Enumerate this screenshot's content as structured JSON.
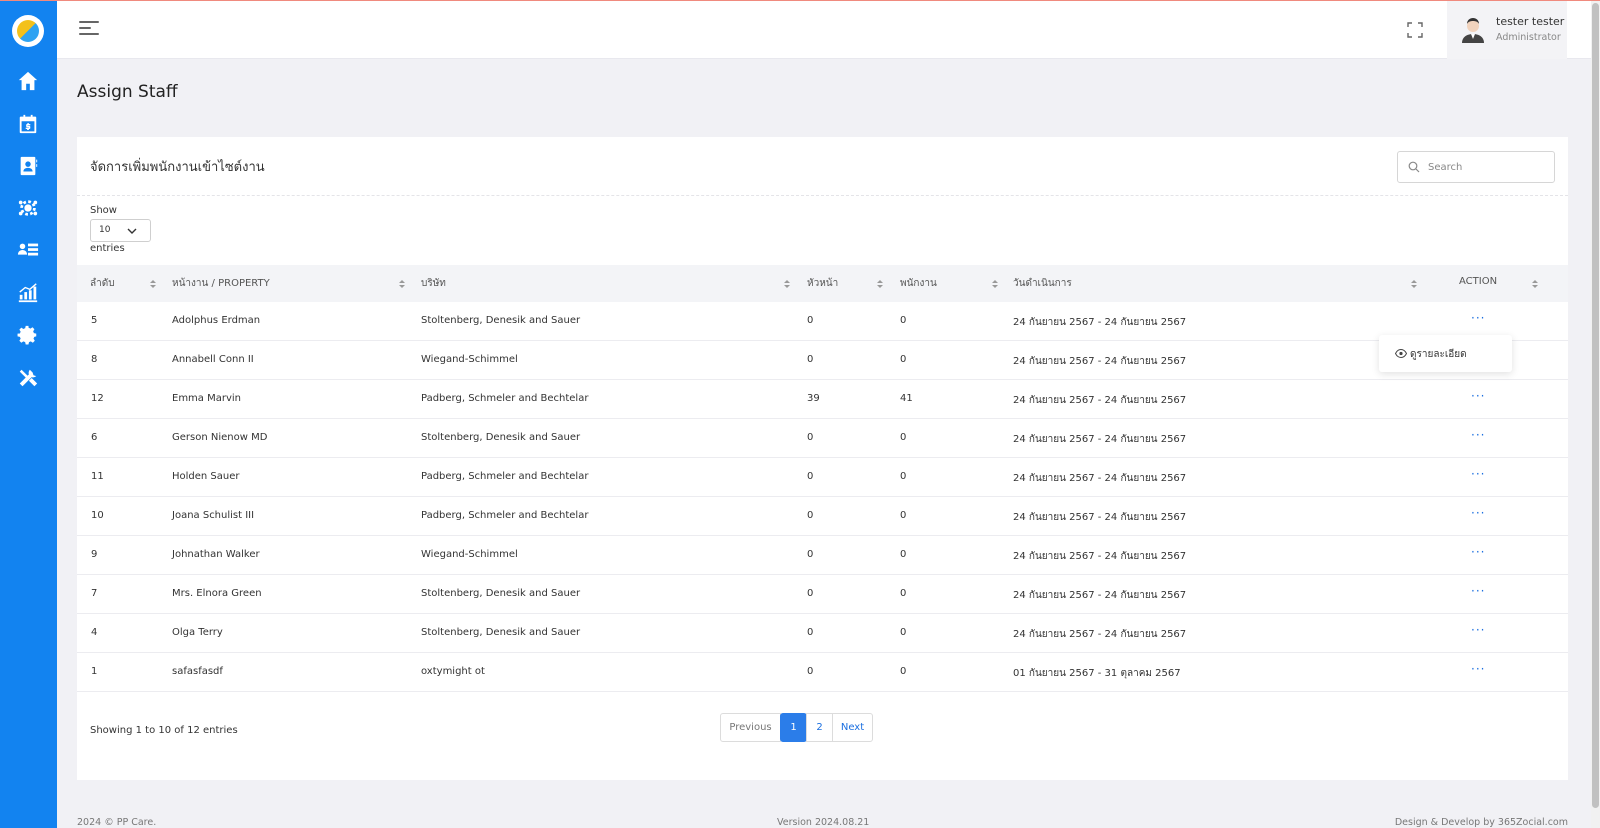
{
  "app": {
    "brand_color": "#1283f0"
  },
  "sidebar": {
    "items": [
      {
        "icon": "home-icon"
      },
      {
        "icon": "calendar-dollar-icon"
      },
      {
        "icon": "contact-book-icon"
      },
      {
        "icon": "team-gear-icon"
      },
      {
        "icon": "staff-list-icon"
      },
      {
        "icon": "bar-chart-icon"
      },
      {
        "icon": "settings-gear-icon"
      },
      {
        "icon": "tools-icon"
      }
    ]
  },
  "header": {
    "user_name": "tester tester",
    "user_role": "Administrator"
  },
  "page": {
    "title": "Assign Staff"
  },
  "card": {
    "title": "จัดการเพิ่มพนักงานเข้าไซต์งาน",
    "search_placeholder": "Search",
    "show_label": "Show",
    "entries_value": "10",
    "entries_label": "entries"
  },
  "table": {
    "headers": [
      "ลำดับ",
      "หน้างาน / PROPERTY",
      "บริษัท",
      "หัวหน้า",
      "พนักงาน",
      "วันดำเนินการ",
      "ACTION"
    ],
    "rows": [
      {
        "no": "5",
        "property": "Adolphus Erdman",
        "company": "Stoltenberg, Denesik and Sauer",
        "head": "0",
        "staff": "0",
        "date": "24 กันยายน 2567 - 24 กันยายน 2567"
      },
      {
        "no": "8",
        "property": "Annabell Conn II",
        "company": "Wiegand-Schimmel",
        "head": "0",
        "staff": "0",
        "date": "24 กันยายน 2567 - 24 กันยายน 2567"
      },
      {
        "no": "12",
        "property": "Emma Marvin",
        "company": "Padberg, Schmeler and Bechtelar",
        "head": "39",
        "staff": "41",
        "date": "24 กันยายน 2567 - 24 กันยายน 2567"
      },
      {
        "no": "6",
        "property": "Gerson Nienow MD",
        "company": "Stoltenberg, Denesik and Sauer",
        "head": "0",
        "staff": "0",
        "date": "24 กันยายน 2567 - 24 กันยายน 2567"
      },
      {
        "no": "11",
        "property": "Holden Sauer",
        "company": "Padberg, Schmeler and Bechtelar",
        "head": "0",
        "staff": "0",
        "date": "24 กันยายน 2567 - 24 กันยายน 2567"
      },
      {
        "no": "10",
        "property": "Joana Schulist III",
        "company": "Padberg, Schmeler and Bechtelar",
        "head": "0",
        "staff": "0",
        "date": "24 กันยายน 2567 - 24 กันยายน 2567"
      },
      {
        "no": "9",
        "property": "Johnathan Walker",
        "company": "Wiegand-Schimmel",
        "head": "0",
        "staff": "0",
        "date": "24 กันยายน 2567 - 24 กันยายน 2567"
      },
      {
        "no": "7",
        "property": "Mrs. Elnora Green",
        "company": "Stoltenberg, Denesik and Sauer",
        "head": "0",
        "staff": "0",
        "date": "24 กันยายน 2567 - 24 กันยายน 2567"
      },
      {
        "no": "4",
        "property": "Olga Terry",
        "company": "Stoltenberg, Denesik and Sauer",
        "head": "0",
        "staff": "0",
        "date": "24 กันยายน 2567 - 24 กันยายน 2567"
      },
      {
        "no": "1",
        "property": "safasfasdf",
        "company": "oxtymight ot",
        "head": "0",
        "staff": "0",
        "date": "01 กันยายน 2567 - 31 ตุลาคม 2567"
      }
    ],
    "action_symbol": "···",
    "dropdown_label": "ดูรายละเอียด"
  },
  "pagination": {
    "info": "Showing 1 to 10 of 12 entries",
    "previous": "Previous",
    "pages": [
      "1",
      "2"
    ],
    "next": "Next"
  },
  "footer": {
    "left": "2024 © PP Care.",
    "center": "Version 2024.08.21",
    "right": "Design & Develop by 365Zocial.com"
  }
}
